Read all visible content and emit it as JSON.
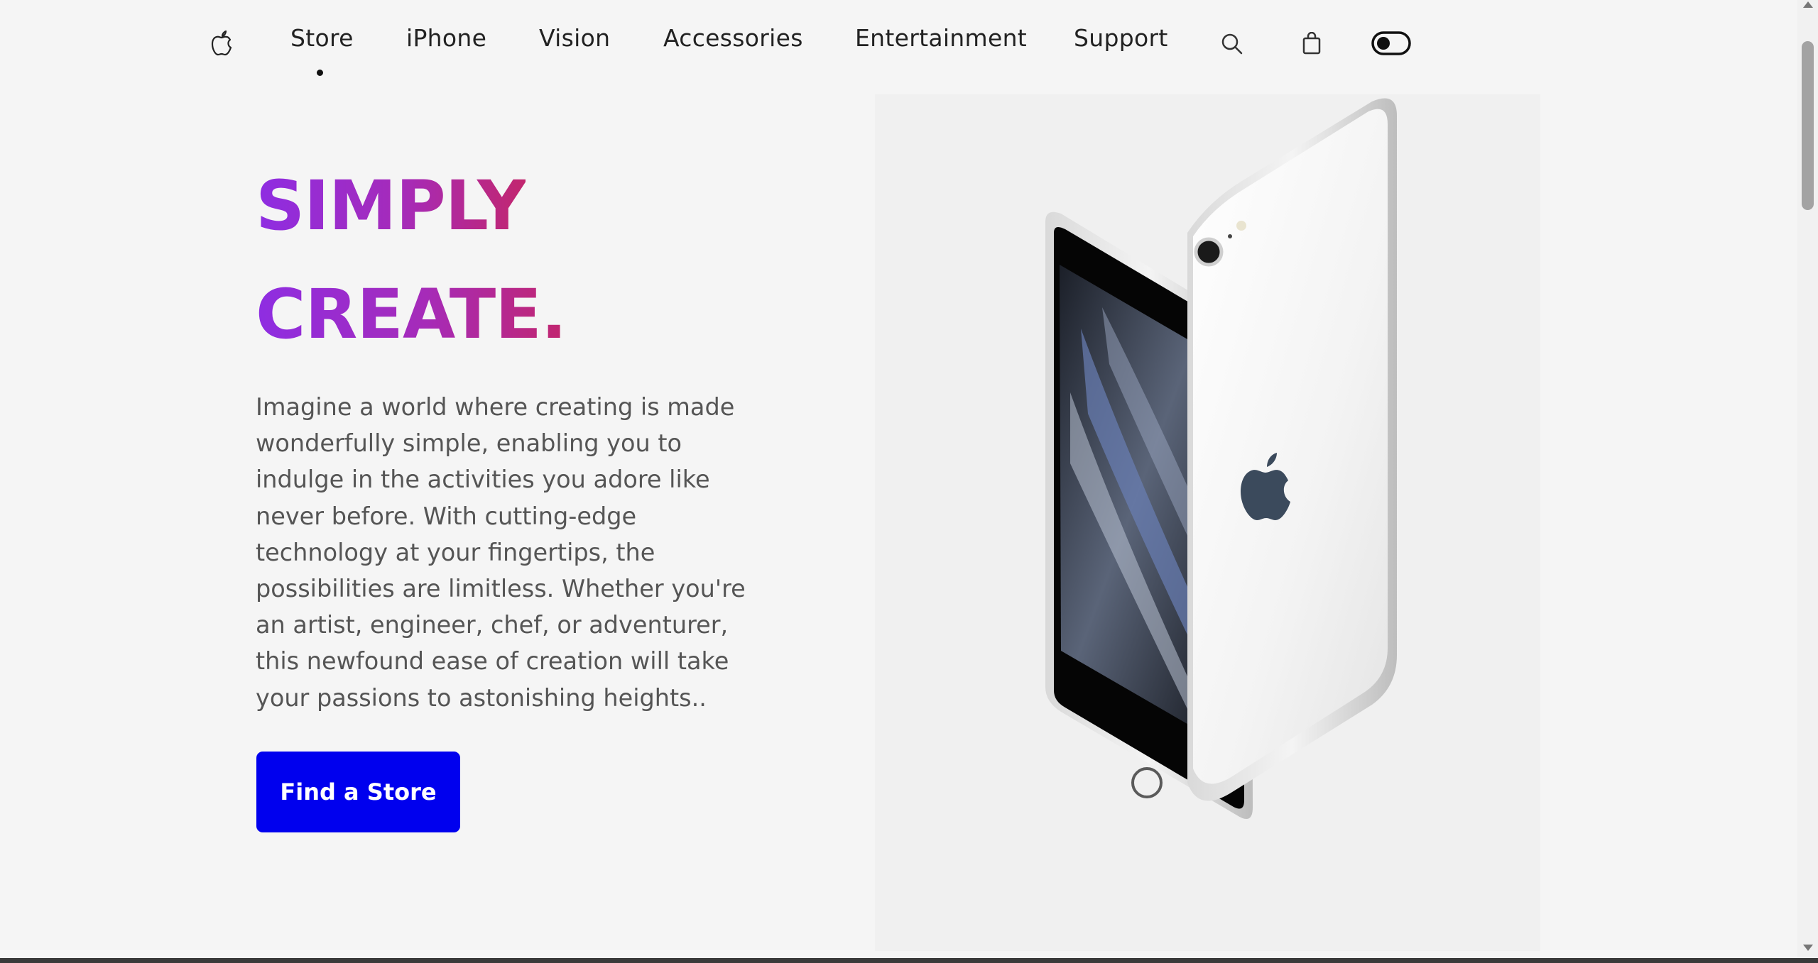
{
  "nav": {
    "items": [
      {
        "label": "Store",
        "active": true
      },
      {
        "label": "iPhone"
      },
      {
        "label": "Vision"
      },
      {
        "label": "Accessories"
      },
      {
        "label": "Entertainment"
      },
      {
        "label": "Support"
      }
    ],
    "icons": [
      "apple-logo-icon",
      "search-icon",
      "bag-icon",
      "theme-toggle-icon"
    ]
  },
  "hero": {
    "title_line1": "SIMPLY",
    "title_line2": "CREATE.",
    "description": "Imagine a world where creating is made wonderfully simple, enabling you to indulge in the activities you adore like never before. With cutting-edge technology at your fingertips, the possibilities are limitless. Whether you're an artist, engineer, chef, or adventurer, this newfound ease of creation will take your passions to astonishing heights..",
    "cta_label": "Find a Store",
    "image": "iphone-front-back-white"
  },
  "colors": {
    "title_gradient_start": "#8e2de2",
    "title_gradient_end": "#c2266e",
    "cta_background": "#0000ee",
    "page_background": "#f5f5f5"
  }
}
